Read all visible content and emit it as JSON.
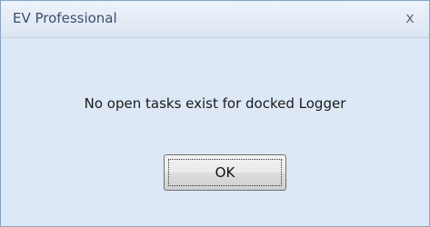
{
  "window": {
    "title": "EV Professional",
    "close_glyph": "x"
  },
  "message": "No open tasks exist for docked Logger",
  "buttons": {
    "ok_label": "OK"
  }
}
